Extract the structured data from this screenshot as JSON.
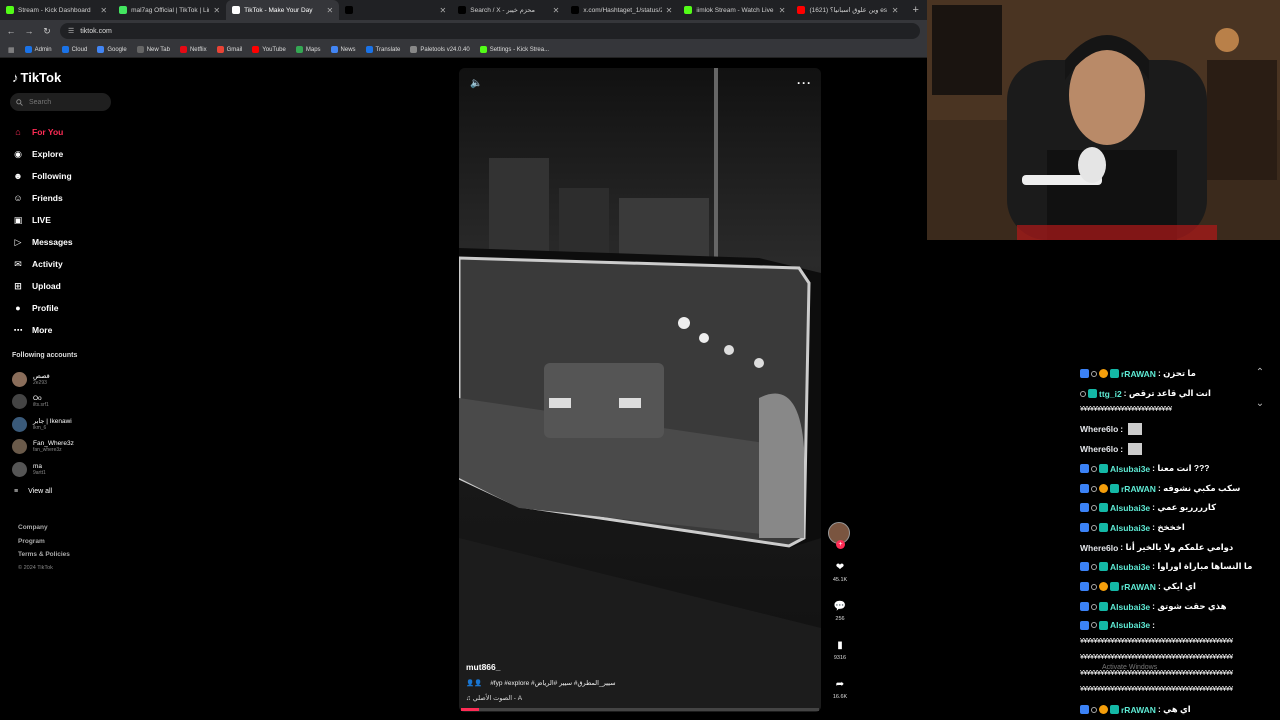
{
  "browser": {
    "tabs": [
      {
        "title": "Stream - Kick Dashboard",
        "color": "#53fc18",
        "active": false
      },
      {
        "title": "mal7ag Official | TikTok | Linktr",
        "color": "#43e660",
        "active": false
      },
      {
        "title": "TikTok - Make Your Day",
        "color": "#ffffff",
        "active": true
      },
      {
        "title": "",
        "color": "#000000",
        "active": false
      },
      {
        "title": "Search / X - محزم خيبر",
        "color": "#000000",
        "active": false
      },
      {
        "title": "x.com/Hashtaget_1/status/280",
        "color": "#000000",
        "active": false
      },
      {
        "title": "iimlok Stream - Watch Live on",
        "color": "#53fc18",
        "active": false
      },
      {
        "title": "(1621) وين علوق اسبانيا؟ es البقاء",
        "color": "#ff0000",
        "active": false
      }
    ],
    "url": "tiktok.com",
    "bookmarks": [
      "Admin",
      "Cloud",
      "Google",
      "New Tab",
      "Netflix",
      "Gmail",
      "YouTube",
      "Maps",
      "News",
      "Translate",
      "Paletools v24.0.40",
      "Settings - Kick Strea..."
    ]
  },
  "tiktok": {
    "logo": "TikTok",
    "search_placeholder": "Search",
    "nav": [
      {
        "label": "For You",
        "icon": "home-icon"
      },
      {
        "label": "Explore",
        "icon": "compass-icon"
      },
      {
        "label": "Following",
        "icon": "following-icon"
      },
      {
        "label": "Friends",
        "icon": "friends-icon"
      },
      {
        "label": "LIVE",
        "icon": "live-icon"
      },
      {
        "label": "Messages",
        "icon": "messages-icon"
      },
      {
        "label": "Activity",
        "icon": "activity-icon"
      },
      {
        "label": "Upload",
        "icon": "upload-icon"
      },
      {
        "label": "Profile",
        "icon": "profile-icon"
      },
      {
        "label": "More",
        "icon": "more-icon"
      }
    ],
    "following_title": "Following accounts",
    "following": [
      {
        "name": "قصص",
        "sub": "2e293"
      },
      {
        "name": "Oo",
        "sub": "ilts.srf1"
      },
      {
        "name": "جابر | Ikenawi",
        "sub": "ikm_6"
      },
      {
        "name": "Fan_Where3z",
        "sub": "fan_where3z"
      },
      {
        "name": "ma",
        "sub": "9artt1"
      }
    ],
    "view_all": "View all",
    "footer": [
      "Company",
      "Program",
      "Terms & Policies"
    ],
    "copyright": "© 2024 TikTok",
    "video": {
      "author": "mut866_",
      "caption": "#fyp #explore #سيير_المطرق# سيير #الرياض",
      "sound": "الصوت الأصلي - A",
      "likes": "45.1K",
      "comments": "256",
      "saves": "9316",
      "shares": "16.6K",
      "progress": 0.05
    }
  },
  "chat": {
    "messages": [
      {
        "user": "rRAWAN",
        "text": ": ما تحزن",
        "badges": [
          "b1",
          "b2",
          "b3",
          "b4"
        ],
        "color": "u-green"
      },
      {
        "user": "ttg_i2",
        "text": ": انت الي قاعد ترقص",
        "badges": [
          "b2",
          "b4"
        ],
        "color": "u-green"
      },
      {
        "hash": "¥¥¥¥¥¥¥¥¥¥¥¥¥¥¥¥¥¥¥¥¥¥¥¥¥¥¥"
      },
      {
        "user": "Where6lo",
        "text": ":",
        "badges": [],
        "color": "u-white",
        "emote": true
      },
      {
        "user": "Where6lo",
        "text": ":",
        "badges": [],
        "color": "u-white",
        "emote": true
      },
      {
        "user": "Alsubai3e",
        "text": ": انت معنا ???",
        "badges": [
          "b1",
          "b2",
          "b4"
        ],
        "color": "u-green"
      },
      {
        "user": "rRAWAN",
        "text": ": سكب مكبي نشوفه",
        "badges": [
          "b1",
          "b2",
          "b3",
          "b4"
        ],
        "color": "u-green"
      },
      {
        "user": "Alsubai3e",
        "text": ": كارررريو عمي",
        "badges": [
          "b1",
          "b2",
          "b4"
        ],
        "color": "u-green"
      },
      {
        "user": "Alsubai3e",
        "text": ": اخخخخ",
        "badges": [
          "b1",
          "b2",
          "b4"
        ],
        "color": "u-green"
      },
      {
        "user": "Where6lo",
        "text": ": دوامي علمكم ولا بالخير أنا",
        "badges": [],
        "color": "u-white"
      },
      {
        "user": "Alsubai3e",
        "text": ": ما النساها مباراة اوراوا",
        "badges": [
          "b1",
          "b2",
          "b4"
        ],
        "color": "u-green"
      },
      {
        "user": "rRAWAN",
        "text": ": اي ايكي",
        "badges": [
          "b1",
          "b2",
          "b3",
          "b4"
        ],
        "color": "u-green"
      },
      {
        "user": "Alsubai3e",
        "text": ": هذي حقت شوتق",
        "badges": [
          "b1",
          "b2",
          "b4"
        ],
        "color": "u-green"
      },
      {
        "user": "Alsubai3e",
        "text": ":",
        "badges": [
          "b1",
          "b2",
          "b4"
        ],
        "color": "u-green"
      },
      {
        "hash": "¥¥¥¥¥¥¥¥¥¥¥¥¥¥¥¥¥¥¥¥¥¥¥¥¥¥¥¥¥¥¥¥¥¥¥¥¥¥¥¥¥¥¥¥¥"
      },
      {
        "hash": "¥¥¥¥¥¥¥¥¥¥¥¥¥¥¥¥¥¥¥¥¥¥¥¥¥¥¥¥¥¥¥¥¥¥¥¥¥¥¥¥¥¥¥¥¥"
      },
      {
        "hash": "¥¥¥¥¥¥¥¥¥¥¥¥¥¥¥¥¥¥¥¥¥¥¥¥¥¥¥¥¥¥¥¥¥¥¥¥¥¥¥¥¥¥¥¥¥"
      },
      {
        "hash": "¥¥¥¥¥¥¥¥¥¥¥¥¥¥¥¥¥¥¥¥¥¥¥¥¥¥¥¥¥¥¥¥¥¥¥¥¥¥¥¥¥¥¥¥¥"
      },
      {
        "user": "rRAWAN",
        "text": ": اي هي",
        "badges": [
          "b1",
          "b2",
          "b3",
          "b4"
        ],
        "color": "u-green"
      }
    ],
    "watermark": "Activate Windows"
  }
}
